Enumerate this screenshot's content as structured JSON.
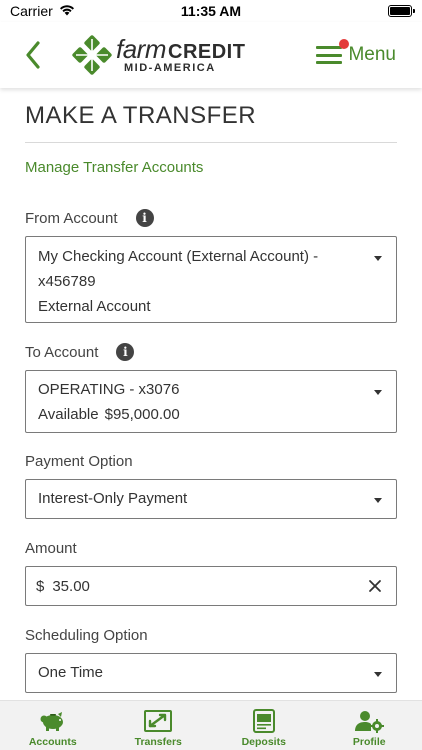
{
  "status_bar": {
    "carrier": "Carrier",
    "time": "11:35 AM"
  },
  "header": {
    "logo_word1": "farm",
    "logo_word2": "CREDIT",
    "logo_sub": "MID-AMERICA",
    "menu_label": "Menu"
  },
  "page": {
    "title": "MAKE A TRANSFER",
    "manage_link": "Manage Transfer Accounts"
  },
  "from_account": {
    "label": "From Account",
    "line1": "My Checking Account (External Account) -",
    "line2": "x456789",
    "line3": "External Account"
  },
  "to_account": {
    "label": "To Account",
    "line1": "OPERATING - x3076",
    "available_label": "Available",
    "available_value": "$95,000.00"
  },
  "payment_option": {
    "label": "Payment Option",
    "value": "Interest-Only Payment"
  },
  "amount": {
    "label": "Amount",
    "currency": "$",
    "value": "35.00"
  },
  "scheduling_option": {
    "label": "Scheduling Option",
    "value": "One Time"
  },
  "tabs": [
    {
      "label": "Accounts",
      "icon": "piggy-bank-icon"
    },
    {
      "label": "Transfers",
      "icon": "transfer-arrows-icon"
    },
    {
      "label": "Deposits",
      "icon": "check-deposit-icon"
    },
    {
      "label": "Profile",
      "icon": "profile-gear-icon"
    }
  ],
  "colors": {
    "brand_green": "#4a8a2c",
    "notification_red": "#e33a3a"
  }
}
